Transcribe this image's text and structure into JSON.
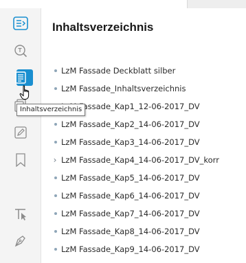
{
  "panel": {
    "title": "Inhaltsverzeichnis"
  },
  "toc": [
    {
      "label": "LzM Fassade Deckblatt silber",
      "marker": "bullet"
    },
    {
      "label": "LzM Fassade_Inhaltsverzeichnis",
      "marker": "bullet"
    },
    {
      "label": "LzM Fassade_Kap1_12-06-2017_DV",
      "marker": "bullet"
    },
    {
      "label": "LzM Fassade_Kap2_14-06-2017_DV",
      "marker": "bullet"
    },
    {
      "label": "LzM Fassade_Kap3_14-06-2017_DV",
      "marker": "bullet"
    },
    {
      "label": "LzM Fassade_Kap4_14-06-2017_DV_korr",
      "marker": "chevron"
    },
    {
      "label": "LzM Fassade_Kap5_14-06-2017_DV",
      "marker": "bullet"
    },
    {
      "label": "LzM Fassade_Kap6_14-06-2017_DV",
      "marker": "bullet"
    },
    {
      "label": "LzM Fassade_Kap7_14-06-2017_DV",
      "marker": "bullet"
    },
    {
      "label": "LzM Fassade_Kap8_14-06-2017_DV",
      "marker": "bullet"
    },
    {
      "label": "LzM Fassade_Kap9_14-06-2017_DV",
      "marker": "bullet"
    }
  ],
  "tooltip": {
    "text": "Inhaltsverzeichnis"
  },
  "toolbar": {
    "tools": [
      {
        "icon": "expand-panel-icon",
        "active": false
      },
      {
        "icon": "search-icon",
        "active": false
      },
      {
        "icon": "table-of-contents-icon",
        "active": true
      },
      {
        "icon": "pages-icon",
        "active": false
      },
      {
        "icon": "annotation-icon",
        "active": false
      },
      {
        "icon": "bookmark-icon",
        "active": false
      },
      {
        "icon": "text-select-icon",
        "active": false
      },
      {
        "icon": "sign-icon",
        "active": false
      }
    ]
  },
  "colors": {
    "accent": "#1a8fd0",
    "toolbar_bg": "#f4f4f4",
    "icon_gray": "#8c8c8c",
    "bullet": "#8fa6b8"
  }
}
